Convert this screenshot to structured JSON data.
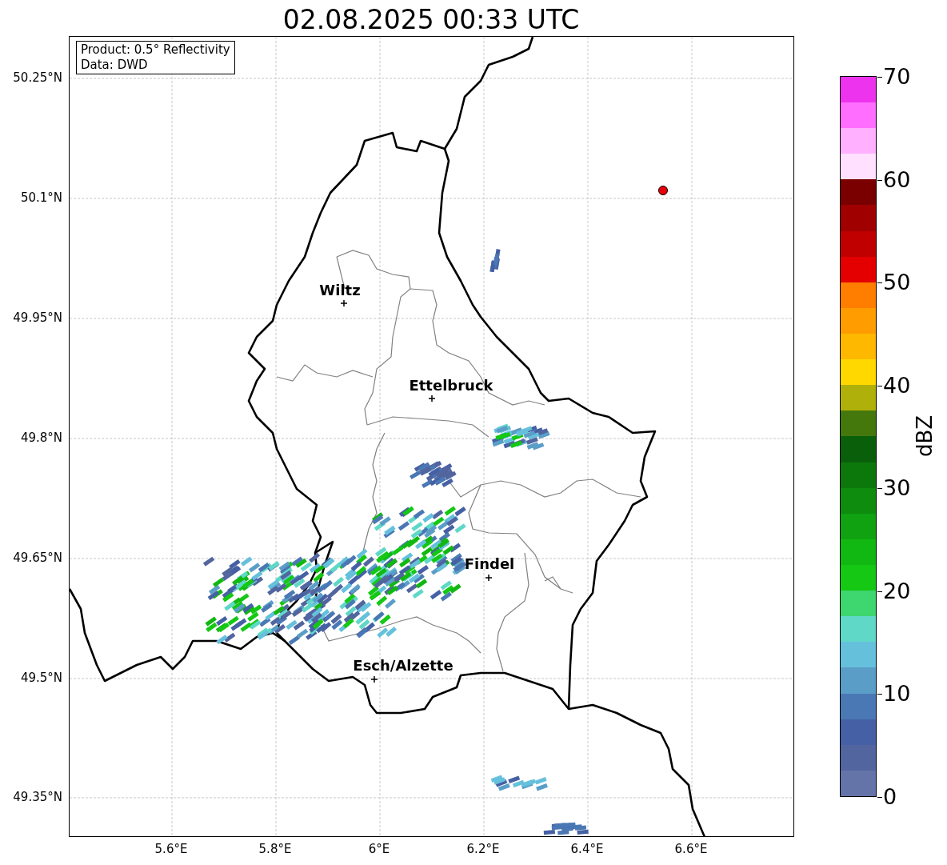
{
  "title": "02.08.2025 00:33 UTC",
  "info_box": [
    "Product: 0.5° Reflectivity",
    "Data: DWD"
  ],
  "latitude_ticks": [
    "50.25°N",
    "50.1°N",
    "49.95°N",
    "49.8°N",
    "49.65°N",
    "49.5°N",
    "49.35°N"
  ],
  "longitude_ticks": [
    "5.6°E",
    "5.8°E",
    "6°E",
    "6.2°E",
    "6.4°E",
    "6.6°E"
  ],
  "cities": [
    {
      "name": "Wiltz"
    },
    {
      "name": "Ettelbruck"
    },
    {
      "name": "Findel"
    },
    {
      "name": "Esch/Alzette"
    }
  ],
  "colorbar": {
    "label": "dBZ",
    "ticks": [
      "70",
      "60",
      "50",
      "40",
      "30",
      "20",
      "10",
      "0"
    ],
    "segments": [
      {
        "color": "#6474a8"
      },
      {
        "color": "#52659e"
      },
      {
        "color": "#4560a4"
      },
      {
        "color": "#4a78b4"
      },
      {
        "color": "#5a9ec8"
      },
      {
        "color": "#65c0dc"
      },
      {
        "color": "#60d8c8"
      },
      {
        "color": "#3ed66e"
      },
      {
        "color": "#14c814"
      },
      {
        "color": "#12b812"
      },
      {
        "color": "#10a210"
      },
      {
        "color": "#0e8c0e"
      },
      {
        "color": "#0c780c"
      },
      {
        "color": "#0a600a"
      },
      {
        "color": "#44780c"
      },
      {
        "color": "#b0b00a"
      },
      {
        "color": "#ffd800"
      },
      {
        "color": "#ffb800"
      },
      {
        "color": "#ff9c00"
      },
      {
        "color": "#ff7e00"
      },
      {
        "color": "#e40000"
      },
      {
        "color": "#c00000"
      },
      {
        "color": "#a00000"
      },
      {
        "color": "#7a0000"
      },
      {
        "color": "#ffe0ff"
      },
      {
        "color": "#ffb0ff"
      },
      {
        "color": "#ff6eff"
      },
      {
        "color": "#ee33ee"
      }
    ]
  }
}
